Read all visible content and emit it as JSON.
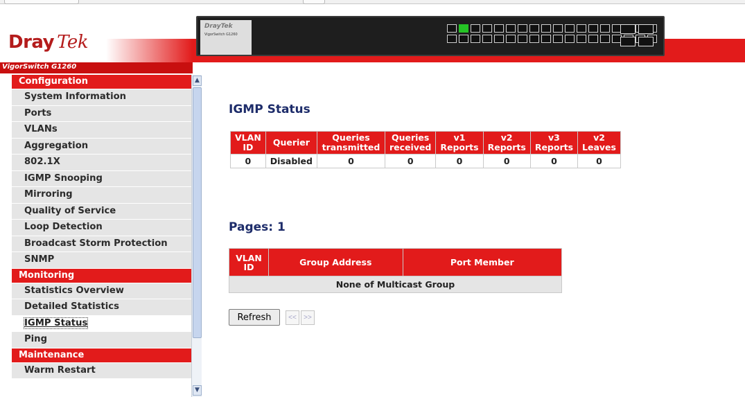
{
  "brand": {
    "name": "Dray",
    "name2": "Tek",
    "model": "VigorSwitch G1260",
    "device_plate_brand": "DrayTek",
    "device_plate_model": "VigorSwitch G1260"
  },
  "sidebar": {
    "sections": [
      {
        "title": "Configuration",
        "items": [
          "System Information",
          "Ports",
          "VLANs",
          "Aggregation",
          "802.1X",
          "IGMP Snooping",
          "Mirroring",
          "Quality of Service",
          "Loop Detection",
          "Broadcast Storm Protection",
          "SNMP"
        ]
      },
      {
        "title": "Monitoring",
        "items": [
          "Statistics Overview",
          "Detailed Statistics",
          "IGMP Status",
          "Ping"
        ]
      },
      {
        "title": "Maintenance",
        "items": [
          "Warm Restart"
        ]
      }
    ],
    "active_item": "IGMP Status"
  },
  "main": {
    "title": "IGMP Status",
    "status_table": {
      "headers": [
        "VLAN ID",
        "Querier",
        "Queries transmitted",
        "Queries received",
        "v1 Reports",
        "v2 Reports",
        "v3 Reports",
        "v2 Leaves"
      ],
      "rows": [
        [
          "0",
          "Disabled",
          "0",
          "0",
          "0",
          "0",
          "0",
          "0"
        ]
      ]
    },
    "pages_label": "Pages: 1",
    "group_table": {
      "headers": [
        "VLAN ID",
        "Group Address",
        "Port Member"
      ],
      "empty_message": "None of Multicast Group"
    },
    "buttons": {
      "refresh": "Refresh",
      "prev": "<<",
      "next": ">>"
    }
  },
  "colors": {
    "accent_red": "#e21b1b",
    "title_navy": "#1d2c6a",
    "nav_gray": "#e5e5e5"
  }
}
